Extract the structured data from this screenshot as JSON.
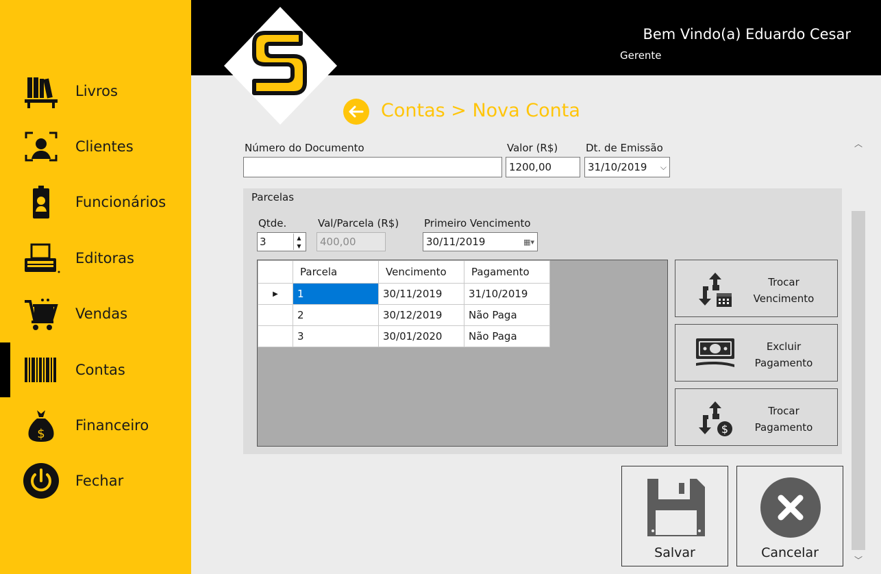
{
  "sidebar": {
    "items": [
      {
        "label": "Livros",
        "icon": "bookshelf-icon"
      },
      {
        "label": "Clientes",
        "icon": "user-frame-icon"
      },
      {
        "label": "Funcionários",
        "icon": "badge-icon"
      },
      {
        "label": "Editoras",
        "icon": "typewriter-icon"
      },
      {
        "label": "Vendas",
        "icon": "cart-icon"
      },
      {
        "label": "Contas",
        "icon": "barcode-icon"
      },
      {
        "label": "Financeiro",
        "icon": "money-bag-icon"
      },
      {
        "label": "Fechar",
        "icon": "power-icon"
      }
    ],
    "active": "Contas"
  },
  "header": {
    "welcome": "Bem Vindo(a) Eduardo Cesar",
    "role": "Gerente"
  },
  "breadcrumb": "Contas > Nova Conta",
  "form": {
    "doc_label": "Número do Documento",
    "doc_value": "",
    "valor_label": "Valor (R$)",
    "valor_value": "1200,00",
    "emissao_label": "Dt. de Emissão",
    "emissao_value": "31/10/2019"
  },
  "parcelas": {
    "title": "Parcelas",
    "qtde_label": "Qtde.",
    "qtde_value": "3",
    "val_label": "Val/Parcela (R$)",
    "val_value": "400,00",
    "venc_label": "Primeiro Vencimento",
    "venc_value": "30/11/2019",
    "columns": [
      "Parcela",
      "Vencimento",
      "Pagamento"
    ],
    "rows": [
      {
        "parcela": "1",
        "vencimento": "30/11/2019",
        "pagamento": "31/10/2019"
      },
      {
        "parcela": "2",
        "vencimento": "30/12/2019",
        "pagamento": "Não Paga"
      },
      {
        "parcela": "3",
        "vencimento": "30/01/2020",
        "pagamento": "Não Paga"
      }
    ]
  },
  "actions": {
    "trocar_venc_1": "Trocar",
    "trocar_venc_2": "Vencimento",
    "excluir_pag_1": "Excluir",
    "excluir_pag_2": "Pagamento",
    "trocar_pag_1": "Trocar",
    "trocar_pag_2": "Pagamento",
    "save": "Salvar",
    "cancel": "Cancelar"
  },
  "colors": {
    "accent": "#ffc50a",
    "header": "#000000",
    "selection": "#0078d7"
  }
}
